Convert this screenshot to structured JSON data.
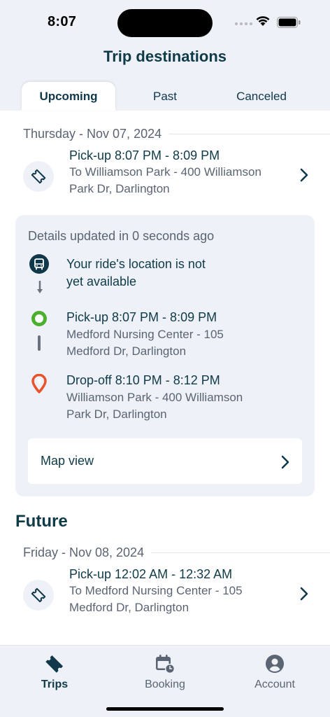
{
  "status_bar": {
    "time": "8:07"
  },
  "header": {
    "title": "Trip destinations"
  },
  "tabs": [
    {
      "label": "Upcoming",
      "active": true
    },
    {
      "label": "Past",
      "active": false
    },
    {
      "label": "Canceled",
      "active": false
    }
  ],
  "upcoming": {
    "date": "Thursday - Nov 07, 2024",
    "trip": {
      "title": "Pick-up 8:07 PM - 8:09 PM",
      "destination_line1": "To Williamson Park - 400 Williamson",
      "destination_line2": "Park Dr, Darlington"
    },
    "details": {
      "updated": "Details updated in 0 seconds ago",
      "ride_location_line1": "Your ride's location is not",
      "ride_location_line2": "yet available",
      "pickup": {
        "title": "Pick-up 8:07 PM - 8:09 PM",
        "address_line1": "Medford Nursing Center - 105",
        "address_line2": "Medford Dr, Darlington"
      },
      "dropoff": {
        "title": "Drop-off 8:10 PM - 8:12 PM",
        "address_line1": "Williamson Park - 400 Williamson",
        "address_line2": "Park Dr, Darlington"
      },
      "map_view_label": "Map view"
    }
  },
  "future": {
    "heading": "Future",
    "date": "Friday - Nov 08, 2024",
    "trip": {
      "title": "Pick-up 12:02 AM - 12:32 AM",
      "destination_line1": "To Medford Nursing Center - 105",
      "destination_line2": "Medford Dr, Darlington"
    }
  },
  "tabbar": {
    "items": [
      {
        "label": "Trips",
        "icon": "ticket-icon",
        "active": true
      },
      {
        "label": "Booking",
        "icon": "calendar-clock-icon",
        "active": false
      },
      {
        "label": "Account",
        "icon": "account-icon",
        "active": false
      }
    ]
  },
  "colors": {
    "primary_text": "#0f3a48",
    "secondary_text": "#5a6472",
    "surface": "#eef1f7",
    "pickup_green": "#4caf2f",
    "dropoff_orange": "#e8532b"
  }
}
